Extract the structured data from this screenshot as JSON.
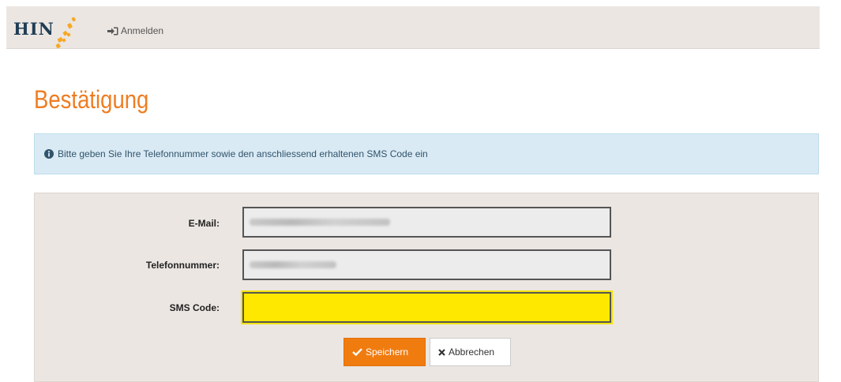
{
  "header": {
    "logo_text": "HIN",
    "login_label": "Anmelden"
  },
  "page": {
    "title": "Bestätigung"
  },
  "info": {
    "message": "Bitte geben Sie Ihre Telefonnummer sowie den anschliessend erhaltenen SMS Code ein"
  },
  "form": {
    "email_label": "E-Mail:",
    "email_value": "",
    "phone_label": "Telefonnummer:",
    "phone_value": "",
    "sms_label": "SMS Code:",
    "sms_value": ""
  },
  "actions": {
    "save_label": "Speichern",
    "cancel_label": "Abbrechen"
  },
  "icons": {
    "login": "sign-in-icon",
    "info": "info-circle-icon",
    "save": "check-icon",
    "cancel": "times-icon"
  },
  "colors": {
    "accent": "#ee7d22",
    "save_button": "#f07c10",
    "info_bg": "#d9eaf4",
    "sms_field": "#ffe800",
    "header_bg": "#ebe6e2",
    "logo": "#1f3d55"
  }
}
